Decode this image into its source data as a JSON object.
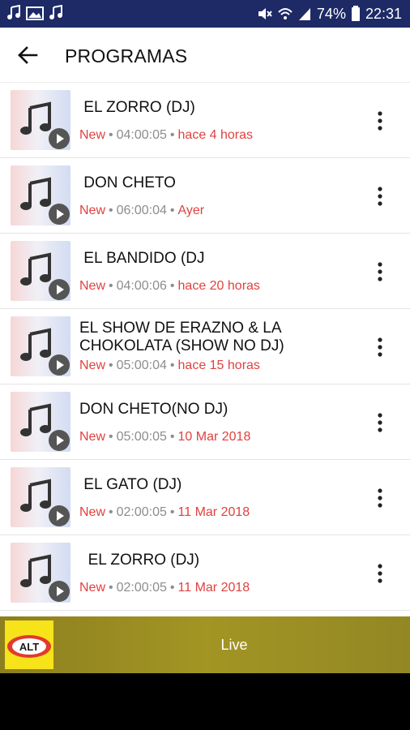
{
  "status_bar": {
    "battery": "74%",
    "time": "22:31"
  },
  "app_bar": {
    "title": "PROGRAMAS"
  },
  "programs": [
    {
      "title": " EL ZORRO (DJ)",
      "badge": "New",
      "duration": "04:00:05",
      "age": "hace 4 horas"
    },
    {
      "title": " DON CHETO",
      "badge": "New",
      "duration": "06:00:04",
      "age": "Ayer"
    },
    {
      "title": " EL BANDIDO (DJ",
      "badge": "New",
      "duration": "04:00:06",
      "age": "hace 20 horas"
    },
    {
      "title": "EL SHOW DE ERAZNO & LA CHOKOLATA (SHOW NO DJ)",
      "badge": "New",
      "duration": "05:00:04",
      "age": "hace 15 horas"
    },
    {
      "title": "DON CHETO(NO DJ)",
      "badge": "New",
      "duration": "05:00:05",
      "age": "10 Mar 2018"
    },
    {
      "title": " EL GATO (DJ)",
      "badge": "New",
      "duration": "02:00:05",
      "age": "11 Mar 2018"
    },
    {
      "title": "  EL ZORRO (DJ)",
      "badge": "New",
      "duration": "02:00:05",
      "age": "11 Mar 2018"
    }
  ],
  "player": {
    "label": "Live",
    "logo_text": "ALT"
  },
  "colors": {
    "status_bar": "#1d2a66",
    "accent_red": "#e0413f",
    "player_bar": "#a29524"
  }
}
